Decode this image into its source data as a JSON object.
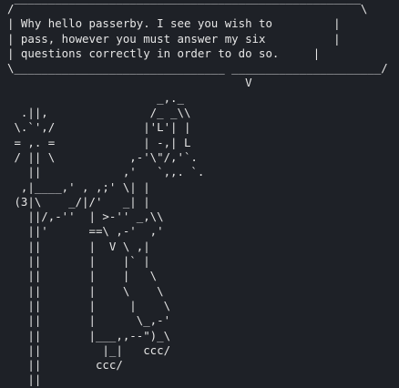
{
  "terminal": {
    "speech_bubble": [
      "/‾‾‾‾‾‾‾‾‾‾‾‾‾‾‾‾‾‾‾‾‾‾‾‾‾‾‾‾‾‾‾‾‾‾‾‾‾‾‾‾‾‾‾‾‾‾‾‾‾‾‾\\",
      "| Why hello passerby. I see you wish to         |",
      "| pass, however you must answer my six          |",
      "| questions correctly in order to do so.     |",
      "\\_______________________________ ______________________/",
      "                                   V"
    ],
    "ascii_art": [
      "                      _,._",
      "  .||,               /_ _\\\\",
      " \\.`',/             |'L'| |",
      " = ,. =             | -,| L",
      " / || \\           ,-'\\\"/,'`.",
      "   ||            ,'   `,,. `.",
      "  ,|____,' , ,;' \\| |",
      " (3|\\    _/|/'   _| |",
      "   ||/,-''  | >-'' _,\\\\",
      "   ||'      ==\\ ,-'  ,'",
      "   ||       |  V \\ ,|",
      "   ||       |    |` |",
      "   ||       |    |   \\",
      "   ||       |    \\    \\",
      "   ||       |     |    \\",
      "   ||       |      \\_,-'",
      "   ||       |___,,--\")_\\",
      "   ||         |_|   ccc/",
      "   ||        ccc/",
      "   ||"
    ]
  }
}
